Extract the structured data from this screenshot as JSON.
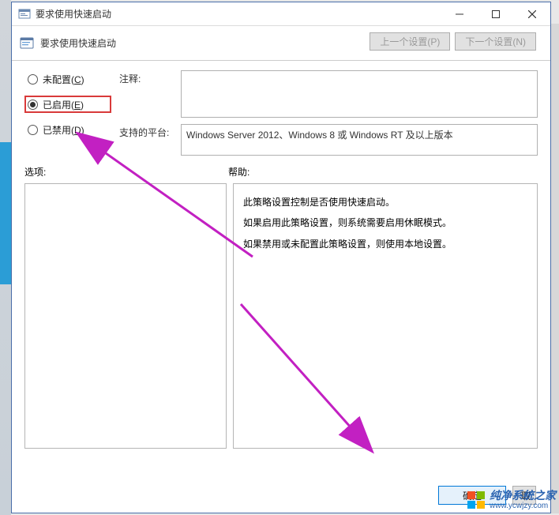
{
  "window": {
    "title": "要求使用快速启动"
  },
  "toolbar": {
    "policy_title": "要求使用快速启动",
    "prev_label": "上一个设置(P)",
    "next_label": "下一个设置(N)"
  },
  "radios": {
    "not_configured": {
      "label": "未配置(",
      "mnemonic": "C",
      "suffix": ")",
      "checked": false
    },
    "enabled": {
      "label": "已启用(",
      "mnemonic": "E",
      "suffix": ")",
      "checked": true
    },
    "disabled": {
      "label": "已禁用(",
      "mnemonic": "D",
      "suffix": ")",
      "checked": false
    }
  },
  "fields": {
    "comment_label": "注释:",
    "comment_value": "",
    "platform_label": "支持的平台:",
    "platform_value": "Windows Server 2012、Windows 8 或 Windows RT 及以上版本"
  },
  "sections": {
    "options_label": "选项:",
    "help_label": "帮助:"
  },
  "help": {
    "line1": "此策略设置控制是否使用快速启动。",
    "line2": "如果启用此策略设置，则系统需要启用休眠模式。",
    "line3": "如果禁用或未配置此策略设置，则使用本地设置。"
  },
  "footer": {
    "ok": "确定",
    "cancel_first_char": "取"
  },
  "watermark": {
    "name": "纯净系统之家",
    "url": "www.ycwjzy.com"
  },
  "colors": {
    "highlight_border": "#d93a3a",
    "arrow": "#c220c2"
  }
}
